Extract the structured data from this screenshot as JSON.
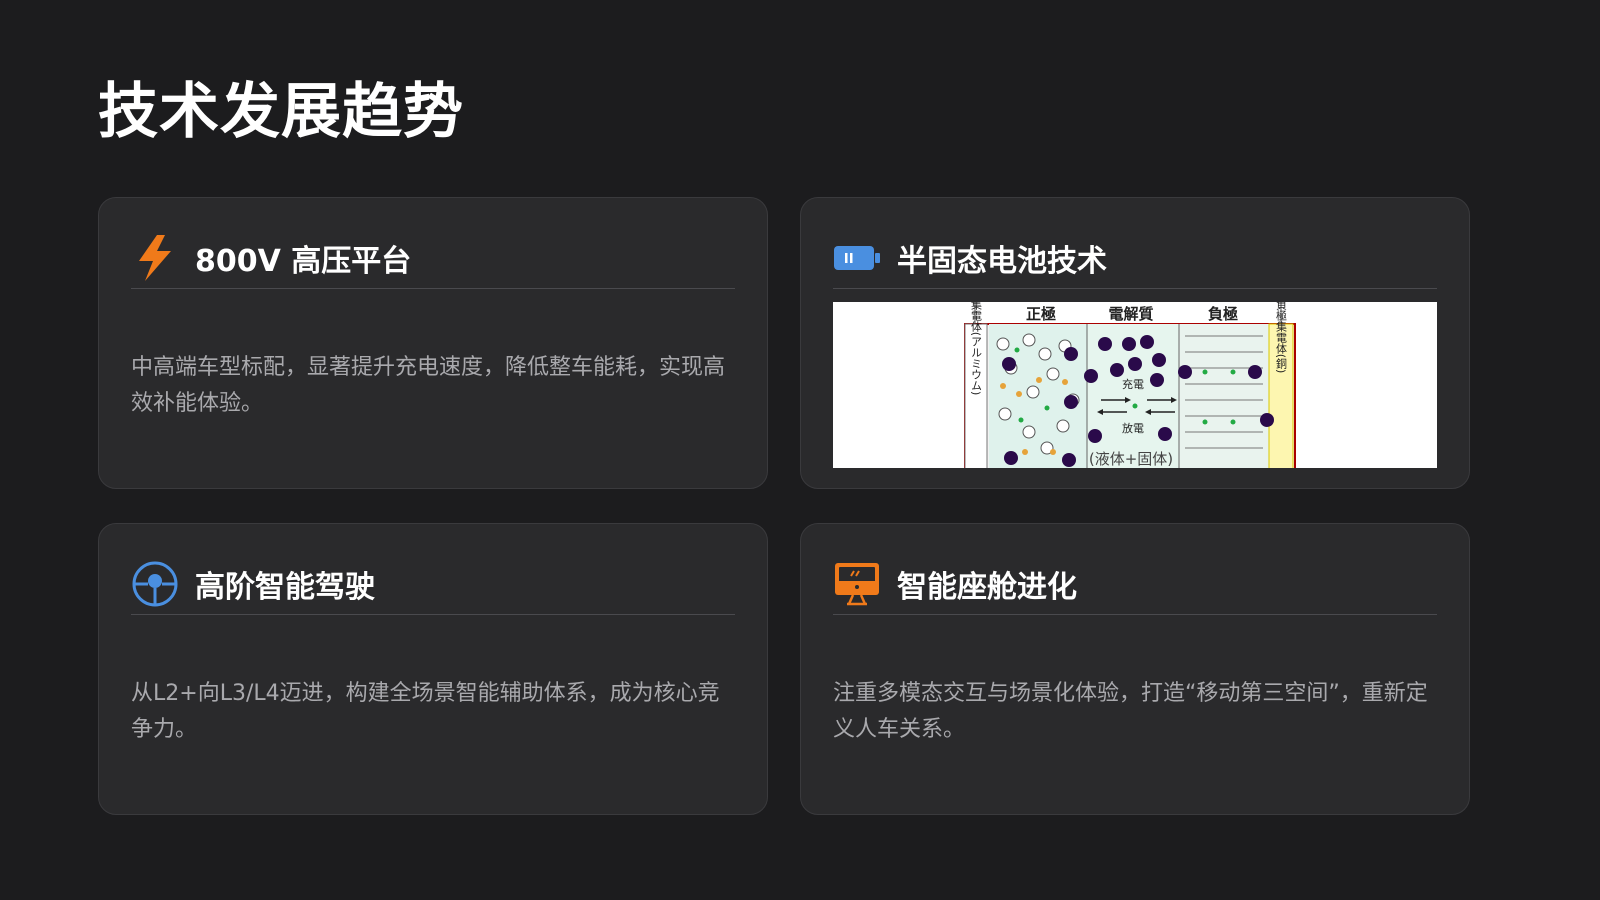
{
  "page": {
    "title": "技术发展趋势"
  },
  "cards": [
    {
      "title": "800V 高压平台",
      "icon": "lightning-bolt-icon",
      "description": "中高端车型标配，显著提升充电速度，降低整车能耗，实现高效补能体验。"
    },
    {
      "title": "半固态电池技术",
      "icon": "battery-icon",
      "diagram": {
        "labels": {
          "cathode": "正極",
          "electrolyte": "電解質",
          "anode": "負極"
        },
        "charge": "充電",
        "discharge": "放電",
        "state": "(液体+固体)",
        "left_collector": "正極集電体(アルミウム)",
        "right_collector": "負極集電体(銅)"
      }
    },
    {
      "title": "高阶智能驾驶",
      "icon": "steering-wheel-icon",
      "description": "从L2+向L3/L4迈进，构建全场景智能辅助体系，成为核心竞争力。"
    },
    {
      "title": "智能座舱进化",
      "icon": "monitor-screen-icon",
      "description": "注重多模态交互与场景化体验，打造“移动第三空间”，重新定义人车关系。"
    }
  ],
  "colors": {
    "background": "#1c1c1e",
    "card": "#2a2a2c",
    "accent_orange": "#f07a1a",
    "accent_blue": "#4a8fe0"
  }
}
